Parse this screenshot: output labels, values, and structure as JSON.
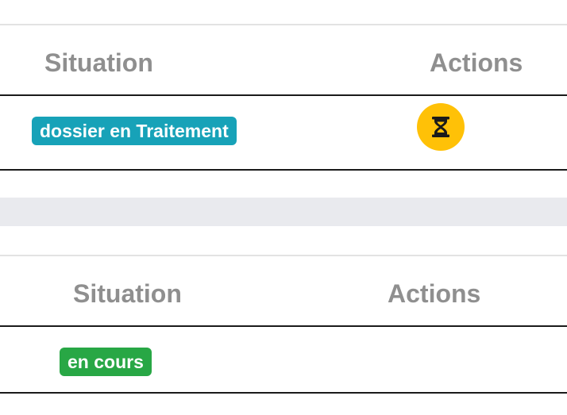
{
  "tables": [
    {
      "headers": {
        "situation": "Situation",
        "actions": "Actions"
      },
      "rows": [
        {
          "status_label": "dossier en Traitement",
          "status_color": "#17a2b8",
          "action_icon": "hourglass-icon",
          "action_color": "#ffc107"
        }
      ]
    },
    {
      "headers": {
        "situation": "Situation",
        "actions": "Actions"
      },
      "rows": [
        {
          "status_label": "en cours",
          "status_color": "#28a745"
        }
      ]
    }
  ]
}
